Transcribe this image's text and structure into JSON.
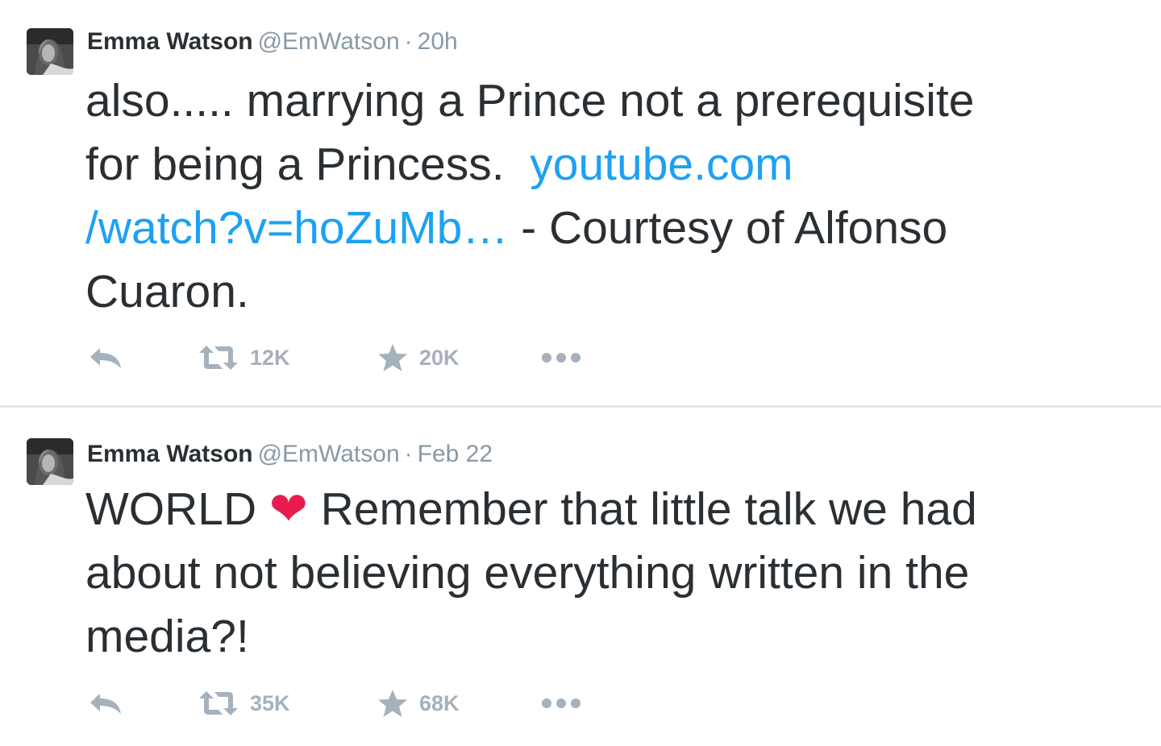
{
  "tweets": [
    {
      "author": {
        "name": "Emma Watson",
        "handle": "@EmWatson"
      },
      "time": "20h",
      "text": {
        "part1": "also..... marrying a Prince not a prerequisite\nfor being a Princess.  ",
        "link": "youtube.com\n/watch?v=hoZuMb…",
        "part2": " - Courtesy of Alfonso\nCuaron."
      },
      "retweets": "12K",
      "favorites": "20K"
    },
    {
      "author": {
        "name": "Emma Watson",
        "handle": "@EmWatson"
      },
      "time": "Feb 22",
      "text": {
        "part1": "WORLD ",
        "emoji": "❤",
        "part2": " Remember that little talk we had\nabout not believing everything written in the\nmedia?!"
      },
      "retweets": "35K",
      "favorites": "68K"
    }
  ],
  "icons": {
    "reply": "reply-icon",
    "retweet": "retweet-icon",
    "favorite": "star-icon",
    "more": "more-dots-icon"
  },
  "colors": {
    "text": "#292f33",
    "meta": "#8899a6",
    "link": "#1da1f2",
    "action": "#a5b1bc",
    "heart": "#e81c4f",
    "divider": "#e1e8ed"
  }
}
